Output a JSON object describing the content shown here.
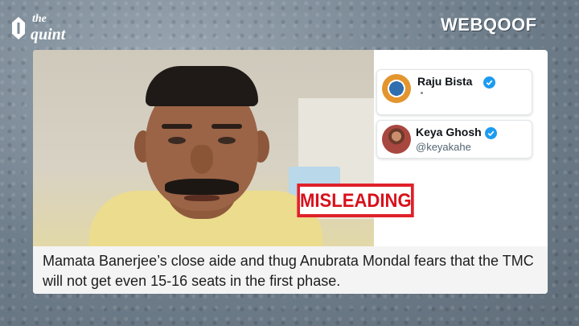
{
  "branding": {
    "quint_logo_line1": "the",
    "quint_logo_line2": "quint",
    "webqoof_logo": "WEBQOOF"
  },
  "video": {
    "verdict_stamp": "MISLEADING"
  },
  "tweets": [
    {
      "name": "Raju Bista",
      "handle": "",
      "verified": true,
      "avatar_icon": "party-emblem-icon"
    },
    {
      "name": "Keya Ghosh",
      "handle": "@keyakahe",
      "verified": true,
      "avatar_icon": "profile-photo-icon"
    }
  ],
  "caption": {
    "text": "Mamata Banerjee’s close aide and thug Anubrata Mondal fears that the TMC will not get even 15-16 seats in the first phase."
  },
  "colors": {
    "verdict_red": "#e0212a",
    "verified_blue": "#1d9bf0"
  }
}
